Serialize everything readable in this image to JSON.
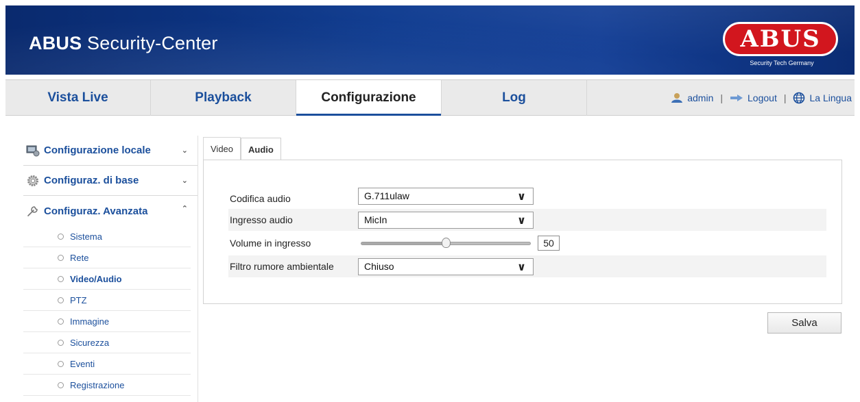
{
  "header": {
    "title_bold": "ABUS",
    "title_rest": " Security-Center",
    "logo_text": "ABUS",
    "logo_tagline": "Security Tech Germany",
    "brand_color": "#d2161e"
  },
  "nav": {
    "tabs": [
      {
        "label": "Vista Live"
      },
      {
        "label": "Playback"
      },
      {
        "label": "Configurazione"
      },
      {
        "label": "Log"
      }
    ],
    "active_tab": "Configurazione",
    "user": {
      "username": "admin",
      "logout_label": "Logout",
      "language_label": "La Lingua",
      "separator": "|"
    }
  },
  "sidebar": {
    "sections": [
      {
        "label": "Configurazione locale",
        "expanded": false,
        "icon": "monitor-config-icon"
      },
      {
        "label": "Configuraz. di base",
        "expanded": false,
        "icon": "gear-icon"
      },
      {
        "label": "Configuraz. Avanzata",
        "expanded": true,
        "icon": "wrench-icon"
      }
    ],
    "advanced_items": [
      {
        "label": "Sistema"
      },
      {
        "label": "Rete"
      },
      {
        "label": "Video/Audio"
      },
      {
        "label": "PTZ"
      },
      {
        "label": "Immagine"
      },
      {
        "label": "Sicurezza"
      },
      {
        "label": "Eventi"
      },
      {
        "label": "Registrazione"
      }
    ],
    "active_item": "Video/Audio"
  },
  "content": {
    "tabs": [
      {
        "label": "Video"
      },
      {
        "label": "Audio"
      }
    ],
    "active_tab": "Audio",
    "fields": {
      "audio_encoding": {
        "label": "Codifica audio",
        "value": "G.711ulaw"
      },
      "audio_input": {
        "label": "Ingresso audio",
        "value": "MicIn"
      },
      "input_volume": {
        "label": "Volume in ingresso",
        "value": "50",
        "level": 50,
        "min": 0,
        "max": 100
      },
      "noise_filter": {
        "label": "Filtro rumore ambientale",
        "value": "Chiuso"
      }
    },
    "save_label": "Salva"
  }
}
